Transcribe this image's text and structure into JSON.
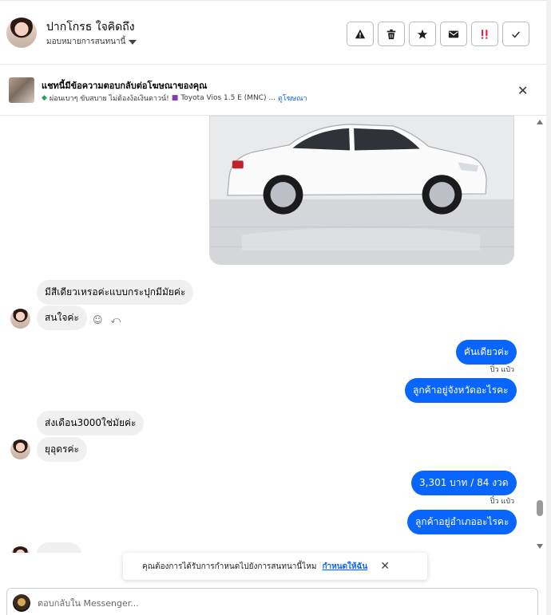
{
  "header": {
    "contact_name": "ปากโกรธ ใจคิดถึง",
    "assign_label": "มอบหมายการสนทนานี้",
    "action_icons": [
      "warning-icon",
      "trash-icon",
      "star-icon",
      "envelope-icon",
      "urgent-icon",
      "check-icon"
    ]
  },
  "ad": {
    "title": "แชทนี้มีข้อความตอบกลับต่อโฆษณาของคุณ",
    "subtitle": "ผ่อนเบาๆ ขับสบาย ไม่ต้องง้อเงินดาวน์!",
    "car_name": "Toyota Vios 1.5 E (MNC) ...",
    "view_ad": "ดูโฆษณา"
  },
  "messages": {
    "m1": "มีสีเดียวเหรอค่ะแบบกระปุกมีมัยค่ะ",
    "m2": "สนใจค่ะ",
    "m3": "คันเดียวค่ะ",
    "m3_sender": "ปิ๋ว แป๋ว",
    "m4": "ลูกค้าอยู่จังหวัดอะไรคะ",
    "m5": "ส่งเดือน3000ใช่มัยค่ะ",
    "m6": "ยุอุดรค่ะ",
    "m7": "3,301 บาท  / 84 งวด",
    "m7_sender": "ปิ๋ว แป๋ว",
    "m8": "ลูกค้าอยู่อำเภออะไรคะ"
  },
  "toast": {
    "text": "คุณต้องการได้รับการกำหนดไปยังการสนทนานี้ไหม",
    "link": "กำหนดให้ฉัน"
  },
  "composer": {
    "placeholder": "ตอบกลับใน Messenger..."
  },
  "colors": {
    "accent": "#0866ff",
    "incoming_bubble": "#f0f0f0",
    "urgent": "#e41e3f"
  }
}
